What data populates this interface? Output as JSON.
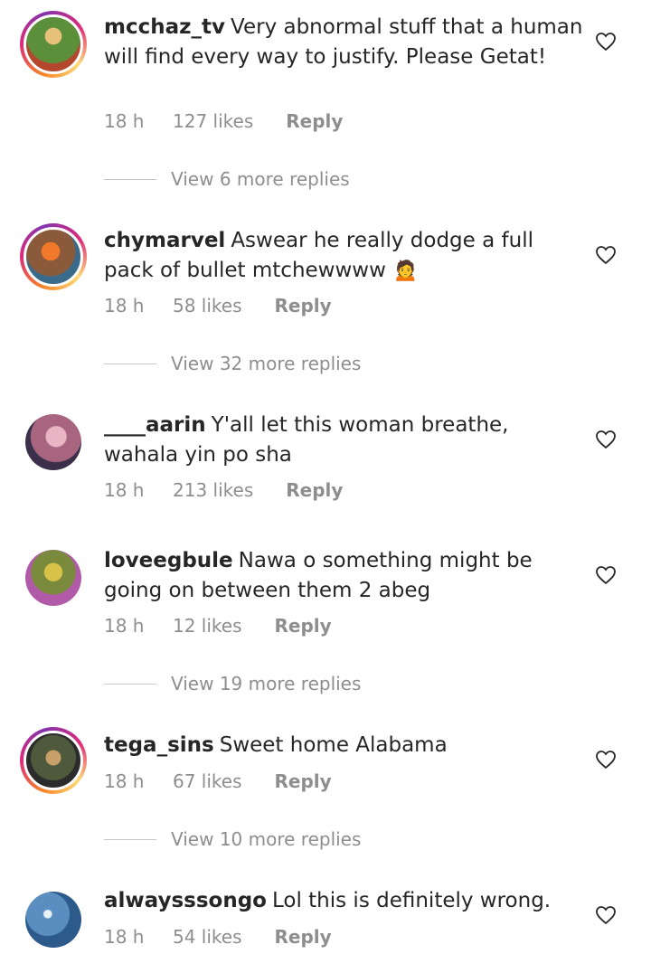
{
  "comments": [
    {
      "username": "mcchaz_tv",
      "text": "Very abnormal stuff that a human will find every way to justify. Please Getat!",
      "time": "18 h",
      "likes": "127 likes",
      "reply": "Reply",
      "view_replies": "View 6 more replies",
      "avatar_color": "#5b8f3a",
      "ring": true
    },
    {
      "username": "chymarvel",
      "text": "Aswear he really dodge a full pack of bullet mtchewwww 🙍",
      "time": "18 h",
      "likes": "58 likes",
      "reply": "Reply",
      "view_replies": "View 32 more replies",
      "avatar_color": "#c96a3c",
      "ring": true
    },
    {
      "username": "____aarin",
      "text": "Y'all let this woman breathe, wahala yin po sha",
      "time": "18 h",
      "likes": "213 likes",
      "reply": "Reply",
      "avatar_color": "#a7657f",
      "ring": false
    },
    {
      "username": "loveegbule",
      "text": "Nawa o something might be going on between them 2 abeg",
      "time": "18 h",
      "likes": "12 likes",
      "reply": "Reply",
      "view_replies": "View 19 more replies",
      "avatar_color": "#7a8a3c",
      "ring": false
    },
    {
      "username": "tega_sins",
      "text": "Sweet home Alabama",
      "time": "18 h",
      "likes": "67 likes",
      "reply": "Reply",
      "view_replies": "View 10 more replies",
      "avatar_color": "#4e5a3b",
      "ring": true
    },
    {
      "username": "alwaysssongo",
      "text": "Lol this is definitely wrong.",
      "time": "18 h",
      "likes": "54 likes",
      "reply": "Reply",
      "avatar_color": "#2c5a8a",
      "ring": false
    }
  ],
  "icons": {
    "like": "heart-outline-icon"
  },
  "colors": {
    "text": "#262626",
    "secondary": "#8e8e8e"
  }
}
